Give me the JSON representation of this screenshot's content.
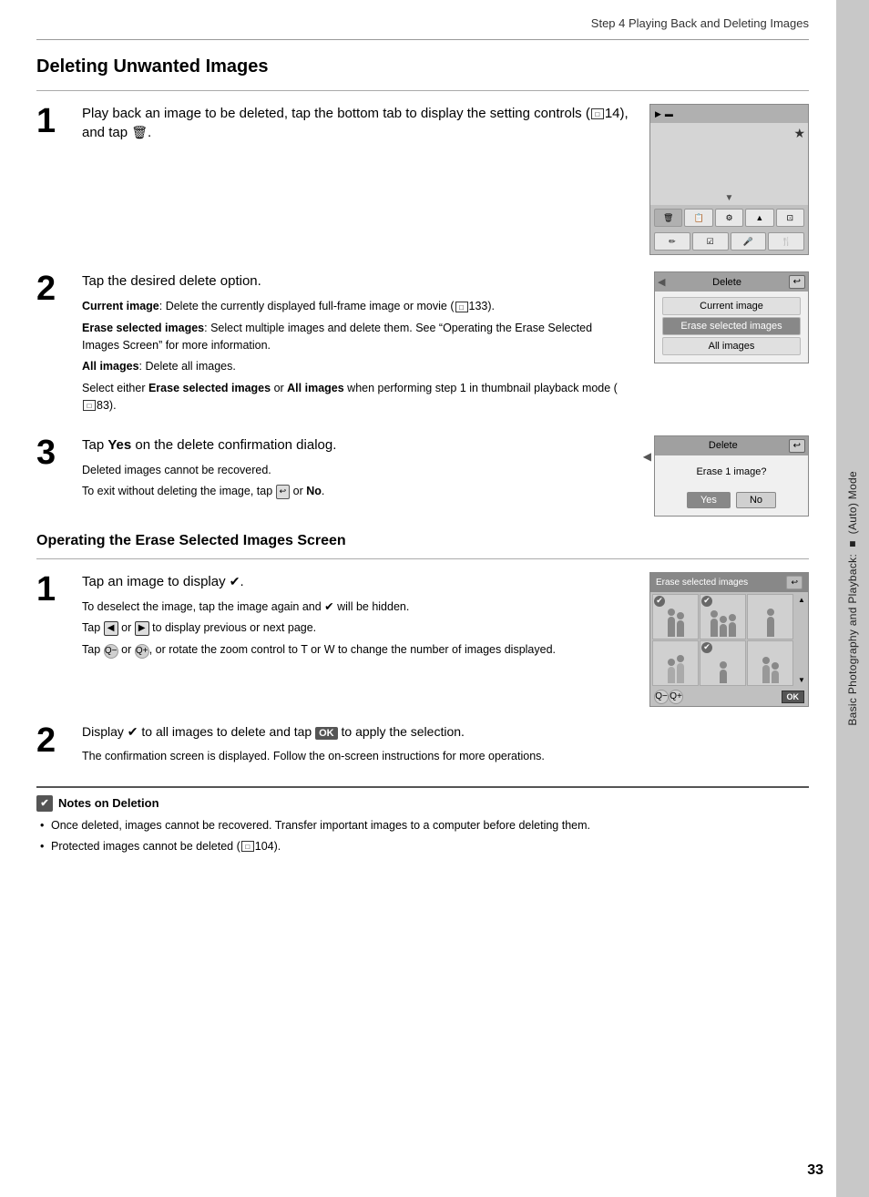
{
  "page": {
    "header": "Step 4 Playing Back and Deleting Images",
    "page_number": "33",
    "sidebar_text": "Basic Photography and Playback: ■ (Auto) Mode"
  },
  "section1": {
    "title": "Deleting Unwanted Images",
    "step1": {
      "number": "1",
      "text": "Play back an image to be deleted, tap the bottom tab to display the setting controls (",
      "ref": "14",
      "text2": "), and tap ",
      "trash_symbol": "🗑"
    },
    "step2": {
      "number": "2",
      "heading": "Tap the desired delete option.",
      "current_image_label": "Current image",
      "current_image_desc": ": Delete the currently displayed full-frame image or movie (",
      "current_image_ref": "133",
      "current_image_desc2": ").",
      "erase_selected_label": "Erase selected images",
      "erase_selected_desc": ": Select multiple images and delete them. See “Operating the Erase Selected Images Screen” for more information.",
      "all_images_label": "All images",
      "all_images_desc": ": Delete all images.",
      "select_note": "Select either ",
      "select_erase": "Erase selected images",
      "select_or": " or ",
      "select_all": "All images",
      "select_note2": " when performing step 1 in thumbnail playback mode (",
      "select_ref": "83",
      "select_note3": ").",
      "menu_title": "Delete",
      "menu_item1": "Current image",
      "menu_item2": "Erase selected images",
      "menu_item3": "All images"
    },
    "step3": {
      "number": "3",
      "heading_bold": "Yes",
      "heading_rest": " on the delete confirmation dialog.",
      "sub1": "Deleted images cannot be recovered.",
      "sub2": "To exit without deleting the image, tap ",
      "back_symbol": "↩",
      "sub2_rest": " or ",
      "no_label": "No",
      "confirm_title": "Delete",
      "confirm_body": "Erase 1 image?",
      "confirm_yes": "Yes",
      "confirm_no": "No"
    }
  },
  "section2": {
    "title": "Operating the Erase Selected Images Screen",
    "step1": {
      "number": "1",
      "text": "Tap an image to display ",
      "check_symbol": "✔",
      "sub1": "To deselect the image, tap the image again and ",
      "check2": "✔",
      "sub1_rest": " will be hidden.",
      "sub2": "Tap ",
      "nav1": "◀",
      "sub2_mid": " or ",
      "nav2": "▶",
      "sub2_rest": " to display previous or next page.",
      "sub3": "Tap ",
      "zoom_out": "Q−",
      "sub3_mid": " or ",
      "zoom_in": "Q+",
      "sub3_rest": ", or rotate the zoom control to T or W to change the number of images displayed.",
      "erase_screen_title": "Erase selected images"
    },
    "step2": {
      "number": "2",
      "text1": "Display ",
      "check": "✔",
      "text2": " to all images to delete and tap ",
      "ok_symbol": "OK",
      "text3": " to apply the selection.",
      "sub1": "The confirmation screen is displayed. Follow the on-screen instructions for more operations."
    }
  },
  "notes": {
    "title": "Notes on Deletion",
    "items": [
      "Once deleted, images cannot be recovered. Transfer important images to a computer before deleting them.",
      "Protected images cannot be deleted (□□ 104)."
    ]
  }
}
